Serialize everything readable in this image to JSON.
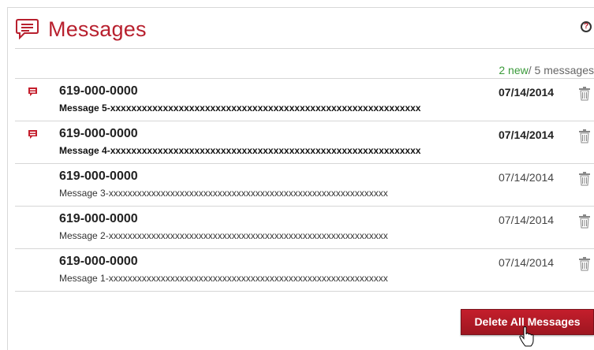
{
  "header": {
    "title": "Messages",
    "help_icon": "question-circle-icon",
    "icon": "chat-bubble-icon"
  },
  "summary": {
    "new_count": "2 new",
    "total": "/ 5 messages"
  },
  "messages": [
    {
      "phone": "619-000-0000",
      "body": "Message 5-xxxxxxxxxxxxxxxxxxxxxxxxxxxxxxxxxxxxxxxxxxxxxxxxxxxxxxxxxxx",
      "date": "07/14/2014",
      "unread": true
    },
    {
      "phone": "619-000-0000",
      "body": "Message 4-xxxxxxxxxxxxxxxxxxxxxxxxxxxxxxxxxxxxxxxxxxxxxxxxxxxxxxxxxxx",
      "date": "07/14/2014",
      "unread": true
    },
    {
      "phone": "619-000-0000",
      "body": "Message 3-xxxxxxxxxxxxxxxxxxxxxxxxxxxxxxxxxxxxxxxxxxxxxxxxxxxxxxxxxxx",
      "date": "07/14/2014",
      "unread": false
    },
    {
      "phone": "619-000-0000",
      "body": "Message 2-xxxxxxxxxxxxxxxxxxxxxxxxxxxxxxxxxxxxxxxxxxxxxxxxxxxxxxxxxxx",
      "date": "07/14/2014",
      "unread": false
    },
    {
      "phone": "619-000-0000",
      "body": "Message 1-xxxxxxxxxxxxxxxxxxxxxxxxxxxxxxxxxxxxxxxxxxxxxxxxxxxxxxxxxxx",
      "date": "07/14/2014",
      "unread": false
    }
  ],
  "actions": {
    "delete_all_label": "Delete All Messages"
  },
  "colors": {
    "accent": "#b8202e",
    "new_count": "#3a9a3a"
  }
}
